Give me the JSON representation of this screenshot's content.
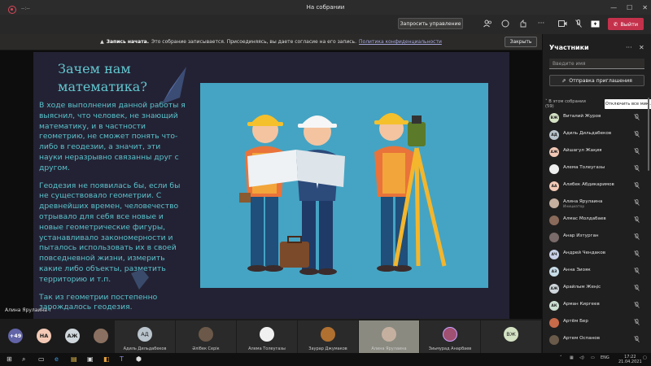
{
  "window": {
    "title": "На собрании"
  },
  "topbar": {
    "timer": "--:--",
    "request_control_label": "Запросить управление",
    "leave_label": "Выйти"
  },
  "banner": {
    "bold": "Запись начата.",
    "text": "Это собрание записывается. Присоединяясь, вы даете согласие на его запись.",
    "link": "Политика конфиденциальности",
    "close_label": "Закрыть"
  },
  "slide": {
    "title": "Зачем нам математика?",
    "paragraphs": [
      "В ходе выполнения данной работы я выяснил, что человек, не знающий математику, и в частности геометрию, не сможет понять что-либо в геодезии, а значит, эти науки неразрывно связанны  друг с другом.",
      "Геодезия не появилась бы, если бы не существовало геометрии. С древнейших времен, человечество  отрывало для себя все новые и новые геометрические фигуры, устанавливало закономерности и пыталось использовать их в своей повседневной жизни, измерить какие либо объекты, разметить территорию и т.п.",
      "Так из геометрии постепенно зарождалось геодезия."
    ]
  },
  "presenter_tag": "Алина Ярулаина",
  "strip": {
    "overflow_count": "+49",
    "circles": [
      {
        "initials": "НА",
        "color": "#f3c9b6"
      },
      {
        "initials": "АЖ",
        "color": "#cfd7dc"
      }
    ],
    "tiles": [
      {
        "label": "Адиль Дильдабеков",
        "initials": "АД",
        "color": "#b9c4cc"
      },
      {
        "label": "Әлібек Серік",
        "initials": "",
        "color": "#6b5848"
      },
      {
        "label": "Алема Толеугазы",
        "initials": "",
        "color": "#f0f0f0"
      },
      {
        "label": "Заурар Джумаков",
        "initials": "",
        "color": "#b07030"
      },
      {
        "label": "Алина Ярулаина",
        "initials": "",
        "color": "#c5b0a0"
      },
      {
        "label": "Зиьмурад Анарбаев",
        "initials": "",
        "color": "#a05070"
      },
      {
        "label": "",
        "initials": "ВЖ",
        "color": "#d4e2c4"
      }
    ]
  },
  "panel": {
    "title": "Участники",
    "search_placeholder": "Введите имя",
    "invite_label": "Отправка приглашения",
    "section_label": "В этом собрании",
    "section_count": "(59)",
    "mute_all_label": "Отключить все мик...",
    "participants": [
      {
        "name": "Виталий Журов",
        "sub": "",
        "initials": "ВЖ",
        "color": "#d4e2c4"
      },
      {
        "name": "Адиль Дильдабеков",
        "sub": "",
        "initials": "АД",
        "color": "#b9c4cc"
      },
      {
        "name": "Айшагул Жақия",
        "sub": "",
        "initials": "АЖ",
        "color": "#f3c9b6"
      },
      {
        "name": "Алема Толеугазы",
        "sub": "",
        "initials": "",
        "color": "#eeeeee"
      },
      {
        "name": "Алибек Абдикаримов",
        "sub": "",
        "initials": "АА",
        "color": "#f3c9b6"
      },
      {
        "name": "Алина Ярулаина",
        "sub": "Инициатор",
        "initials": "",
        "color": "#c5b0a0"
      },
      {
        "name": "Алмас Молдабаев",
        "sub": "",
        "initials": "",
        "color": "#8a6a5a"
      },
      {
        "name": "Анар Изтурган",
        "sub": "",
        "initials": "",
        "color": "#7a6a6a"
      },
      {
        "name": "Андрей Чендаков",
        "sub": "",
        "initials": "АЧ",
        "color": "#c8d0e8"
      },
      {
        "name": "Анна Зиояк",
        "sub": "",
        "initials": "АЗ",
        "color": "#c8dde8"
      },
      {
        "name": "Арайлым Жеңіс",
        "sub": "",
        "initials": "АЖ",
        "color": "#cfd7dc"
      },
      {
        "name": "Арман Киргеев",
        "sub": "",
        "initials": "АК",
        "color": "#cbe0d0"
      },
      {
        "name": "Артём Бер",
        "sub": "",
        "initials": "",
        "color": "#c76a4a"
      },
      {
        "name": "Артем Оспанов",
        "sub": "",
        "initials": "",
        "color": "#6a5a4a"
      }
    ]
  },
  "taskbar": {
    "time": "17:22",
    "date": "21.04.2021",
    "lang": "ENG"
  }
}
